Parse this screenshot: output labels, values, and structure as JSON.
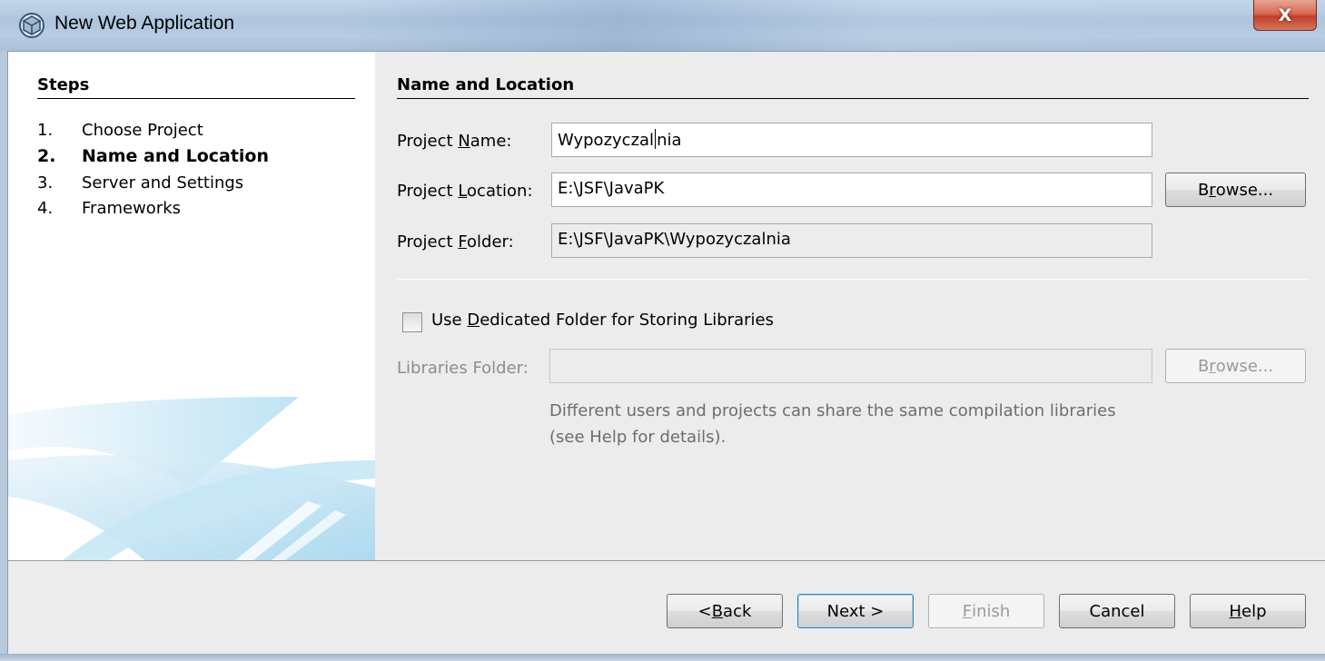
{
  "window": {
    "title": "New Web Application",
    "close_glyph": "X",
    "icon": "netbeans-cube-icon"
  },
  "steps": {
    "heading": "Steps",
    "items": [
      {
        "num": "1.",
        "label": "Choose Project",
        "active": false
      },
      {
        "num": "2.",
        "label": "Name and Location",
        "active": true
      },
      {
        "num": "3.",
        "label": "Server and Settings",
        "active": false
      },
      {
        "num": "4.",
        "label": "Frameworks",
        "active": false
      }
    ]
  },
  "form": {
    "heading": "Name and Location",
    "project_name": {
      "label_pre": "Project ",
      "label_mn": "N",
      "label_post": "ame:",
      "value_a": "Wypozyczal",
      "value_b": "nia"
    },
    "project_location": {
      "label_pre": "Project ",
      "label_mn": "L",
      "label_post": "ocation:",
      "value": "E:\\JSF\\JavaPK",
      "browse_pre": "B",
      "browse_mn": "r",
      "browse_post": "owse..."
    },
    "project_folder": {
      "label_pre": "Project ",
      "label_mn": "F",
      "label_post": "older:",
      "value": "E:\\JSF\\JavaPK\\Wypozyczalnia"
    },
    "dedicated_folder": {
      "label_pre": "Use ",
      "label_mn": "D",
      "label_post": "edicated Folder for Storing Libraries",
      "checked": false
    },
    "libraries_folder": {
      "label": "Libraries Folder:",
      "value": "",
      "browse_pre": "B",
      "browse_mn": "r",
      "browse_post": "owse..."
    },
    "hint_line1": "Different users and projects can share the same compilation libraries",
    "hint_line2": "(see Help for details)."
  },
  "buttons": {
    "back_pre": "< ",
    "back_mn": "B",
    "back_post": "ack",
    "next": "Next >",
    "finish_mn": "F",
    "finish_post": "inish",
    "cancel": "Cancel",
    "help_mn": "H",
    "help_post": "elp"
  },
  "colors": {
    "titlebar": "#b8cce2",
    "close_button": "#c0402a",
    "dialog_background": "#ececec",
    "steps_background": "#ffffff",
    "default_button_border": "#3c7fb1"
  }
}
